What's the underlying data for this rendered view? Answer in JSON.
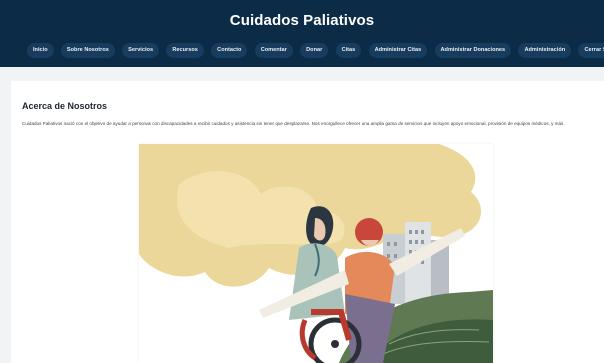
{
  "header": {
    "title": "Cuidados Paliativos"
  },
  "nav": {
    "items": [
      "Inicio",
      "Sobre Nosotros",
      "Servicios",
      "Recursos",
      "Contacto",
      "Comentar",
      "Donar",
      "Citas",
      "Administrar Citas",
      "Administrar Donaciones",
      "Administración",
      "Cerrar Sesión"
    ]
  },
  "about": {
    "title": "Acerca de Nosotros",
    "text": "Cuidados Paliativos nació con el objetivo de ayudar a personas con discapacidades a recibir cuidados y asistencia sin tener que desplazarse. Nos enorgullece ofrecer una amplia gama de servicios que incluyen apoyo emocional, provisión de equipos médicos, y más."
  },
  "colors": {
    "header_bg": "#0c2b47",
    "nav_button_bg": "#173c5e",
    "page_bg": "#f1f3f5",
    "card_bg": "#ffffff"
  }
}
